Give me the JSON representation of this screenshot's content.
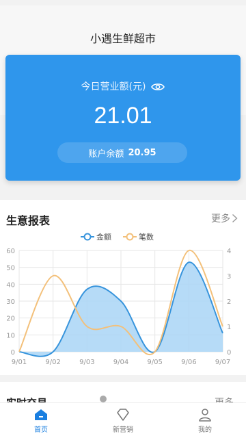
{
  "header": {
    "title": "小遇生鲜超市"
  },
  "revenue": {
    "label": "今日营业额(元)",
    "value": "21.01",
    "balance_label": "账户余额",
    "balance_value": "20.95"
  },
  "report": {
    "title": "生意报表",
    "more": "更多"
  },
  "realtime": {
    "title": "实时交易",
    "more": "更多"
  },
  "tabs": [
    {
      "label": "首页",
      "icon": "home-icon",
      "active": true
    },
    {
      "label": "新营销",
      "icon": "diamond-icon",
      "active": false
    },
    {
      "label": "我的",
      "icon": "user-icon",
      "active": false
    }
  ],
  "colors": {
    "card_blue": "#2f96ec",
    "amount_line": "#3794dc",
    "amount_fill": "#a9d5f6",
    "count_line": "#f3c07a",
    "active_tab": "#1a7fe0"
  },
  "chart_data": {
    "type": "line",
    "categories": [
      "9/01",
      "9/02",
      "9/03",
      "9/04",
      "9/05",
      "9/06",
      "9/07"
    ],
    "series": [
      {
        "name": "金额",
        "axis": "left",
        "area": true,
        "values": [
          0,
          0,
          37,
          30,
          0,
          53,
          11
        ]
      },
      {
        "name": "笔数",
        "axis": "right",
        "area": false,
        "values": [
          0,
          3,
          1,
          1,
          0,
          4,
          1
        ]
      }
    ],
    "y_left_ticks": [
      "0",
      "10",
      "20",
      "30",
      "40",
      "50",
      "60"
    ],
    "y_right_ticks": [
      "0",
      "1",
      "2",
      "3",
      "4"
    ],
    "ylim_left": [
      0,
      60
    ],
    "ylim_right": [
      0,
      4
    ],
    "legend": "top-center",
    "grid": true
  }
}
